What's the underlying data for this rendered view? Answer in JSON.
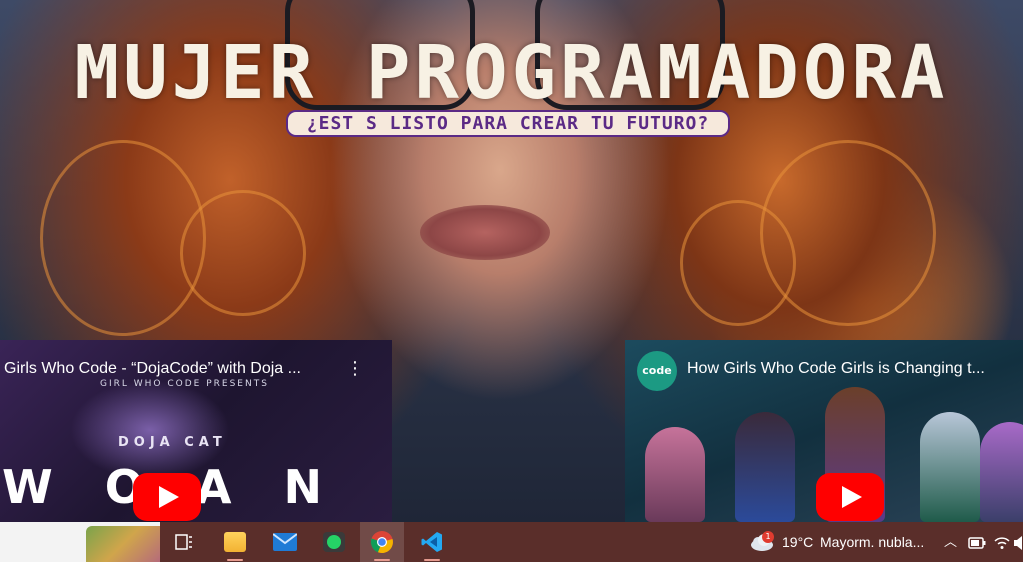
{
  "hero": {
    "title": "MUJER PROGRAMADORA",
    "subtitle": "¿EST  S LISTO PARA CREAR TU FUTURO?"
  },
  "videos": [
    {
      "title": "Girls Who Code - “DojaCode” with Doja ...",
      "presents": "GIRL WHO CODE PRESENTS",
      "artist": "DOJA CAT",
      "art_text": "W O A N"
    },
    {
      "title": "How Girls Who Code Girls is Changing t...",
      "channel": "code"
    }
  ],
  "taskbar": {
    "apps": [
      "task-view",
      "file-explorer",
      "mail",
      "whatsapp",
      "chrome",
      "vscode"
    ],
    "weather": {
      "temp": "19°C",
      "condition": "Mayorm. nubla...",
      "badge": "1"
    }
  },
  "colors": {
    "title": "#f7f1e4",
    "subtitle_bg": "#f6e9dc",
    "subtitle_text": "#5b2a86",
    "youtube_red": "#ff0000",
    "taskbar": "#5a2e2a"
  }
}
